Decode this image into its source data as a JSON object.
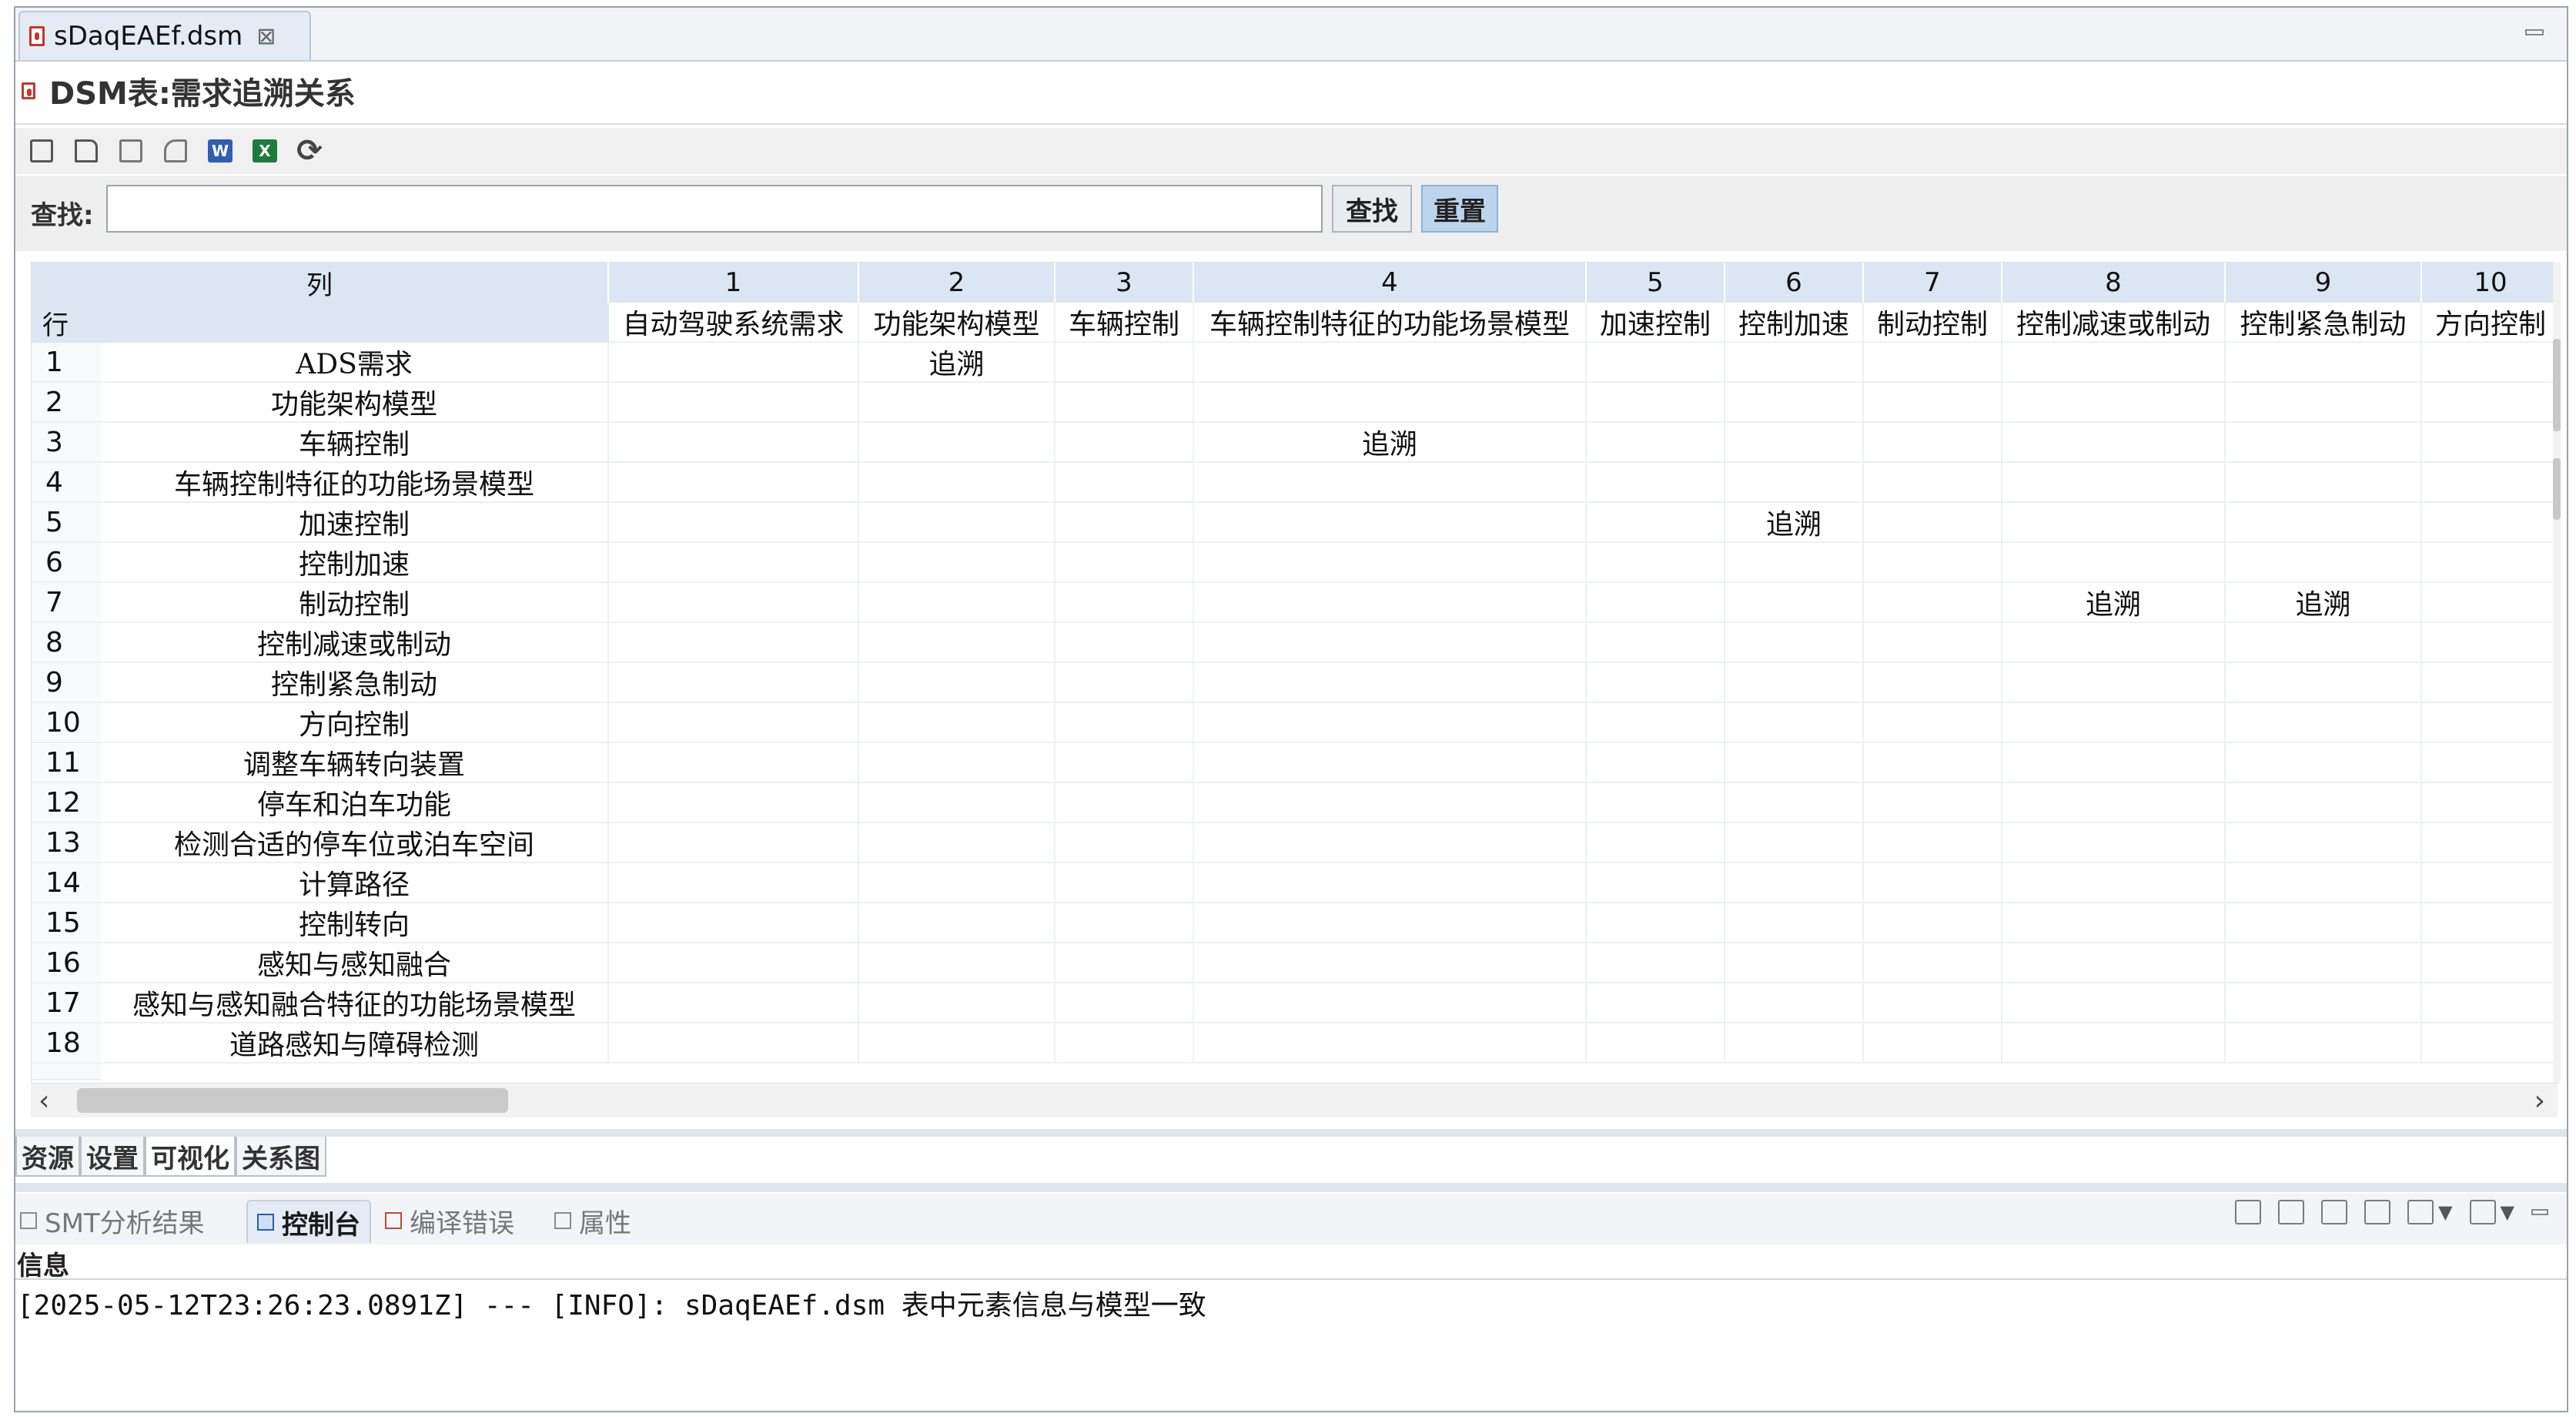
{
  "editor_tab": {
    "label": "sDaqEAEf.dsm",
    "close": "⊠"
  },
  "title": "DSM表:需求追溯关系",
  "toolbar": [
    "generate-icon",
    "new-doc-icon",
    "export-icon",
    "preview-icon",
    "word-icon",
    "excel-icon",
    "refresh-icon"
  ],
  "search": {
    "label": "查找:",
    "value": "",
    "find_button": "查找",
    "reset_button": "重置"
  },
  "table": {
    "corner_top": "列",
    "corner_left": "行",
    "columns": [
      {
        "num": "1",
        "name": "自动驾驶系统需求"
      },
      {
        "num": "2",
        "name": "功能架构模型"
      },
      {
        "num": "3",
        "name": "车辆控制"
      },
      {
        "num": "4",
        "name": "车辆控制特征的功能场景模型"
      },
      {
        "num": "5",
        "name": "加速控制"
      },
      {
        "num": "6",
        "name": "控制加速"
      },
      {
        "num": "7",
        "name": "制动控制"
      },
      {
        "num": "8",
        "name": "控制减速或制动"
      },
      {
        "num": "9",
        "name": "控制紧急制动"
      },
      {
        "num": "10",
        "name": "方向控制"
      }
    ],
    "rows": [
      {
        "num": "1",
        "name": "ADS需求",
        "cells": [
          "",
          "追溯",
          "",
          "",
          "",
          "",
          "",
          "",
          "",
          ""
        ]
      },
      {
        "num": "2",
        "name": "功能架构模型",
        "cells": [
          "",
          "",
          "",
          "",
          "",
          "",
          "",
          "",
          "",
          ""
        ]
      },
      {
        "num": "3",
        "name": "车辆控制",
        "cells": [
          "",
          "",
          "",
          "追溯",
          "",
          "",
          "",
          "",
          "",
          ""
        ]
      },
      {
        "num": "4",
        "name": "车辆控制特征的功能场景模型",
        "cells": [
          "",
          "",
          "",
          "",
          "",
          "",
          "",
          "",
          "",
          ""
        ]
      },
      {
        "num": "5",
        "name": "加速控制",
        "cells": [
          "",
          "",
          "",
          "",
          "",
          "追溯",
          "",
          "",
          "",
          ""
        ]
      },
      {
        "num": "6",
        "name": "控制加速",
        "cells": [
          "",
          "",
          "",
          "",
          "",
          "",
          "",
          "",
          "",
          ""
        ]
      },
      {
        "num": "7",
        "name": "制动控制",
        "cells": [
          "",
          "",
          "",
          "",
          "",
          "",
          "",
          "追溯",
          "追溯",
          ""
        ]
      },
      {
        "num": "8",
        "name": "控制减速或制动",
        "cells": [
          "",
          "",
          "",
          "",
          "",
          "",
          "",
          "",
          "",
          ""
        ]
      },
      {
        "num": "9",
        "name": "控制紧急制动",
        "cells": [
          "",
          "",
          "",
          "",
          "",
          "",
          "",
          "",
          "",
          ""
        ]
      },
      {
        "num": "10",
        "name": "方向控制",
        "cells": [
          "",
          "",
          "",
          "",
          "",
          "",
          "",
          "",
          "",
          ""
        ]
      },
      {
        "num": "11",
        "name": "调整车辆转向装置",
        "cells": [
          "",
          "",
          "",
          "",
          "",
          "",
          "",
          "",
          "",
          ""
        ]
      },
      {
        "num": "12",
        "name": "停车和泊车功能",
        "cells": [
          "",
          "",
          "",
          "",
          "",
          "",
          "",
          "",
          "",
          ""
        ]
      },
      {
        "num": "13",
        "name": "检测合适的停车位或泊车空间",
        "cells": [
          "",
          "",
          "",
          "",
          "",
          "",
          "",
          "",
          "",
          ""
        ]
      },
      {
        "num": "14",
        "name": "计算路径",
        "cells": [
          "",
          "",
          "",
          "",
          "",
          "",
          "",
          "",
          "",
          ""
        ]
      },
      {
        "num": "15",
        "name": "控制转向",
        "cells": [
          "",
          "",
          "",
          "",
          "",
          "",
          "",
          "",
          "",
          ""
        ]
      },
      {
        "num": "16",
        "name": "感知与感知融合",
        "cells": [
          "",
          "",
          "",
          "",
          "",
          "",
          "",
          "",
          "",
          ""
        ]
      },
      {
        "num": "17",
        "name": "感知与感知融合特征的功能场景模型",
        "cells": [
          "",
          "",
          "",
          "",
          "",
          "",
          "",
          "",
          "",
          ""
        ]
      },
      {
        "num": "18",
        "name": "道路感知与障碍检测",
        "cells": [
          "",
          "",
          "",
          "",
          "",
          "",
          "",
          "",
          "",
          ""
        ]
      }
    ]
  },
  "bottom_tabs": [
    "资源",
    "设置",
    "可视化",
    "关系图"
  ],
  "view_tabs": [
    {
      "label": "SMT分析结果",
      "active": false
    },
    {
      "label": "控制台",
      "active": true
    },
    {
      "label": "编译错误",
      "active": false
    },
    {
      "label": "属性",
      "active": false
    }
  ],
  "console": {
    "header": "信息",
    "lines": [
      "[2025-05-12T23:26:23.0891Z] --- [INFO]: sDaqEAEf.dsm 表中元素信息与模型一致"
    ]
  }
}
